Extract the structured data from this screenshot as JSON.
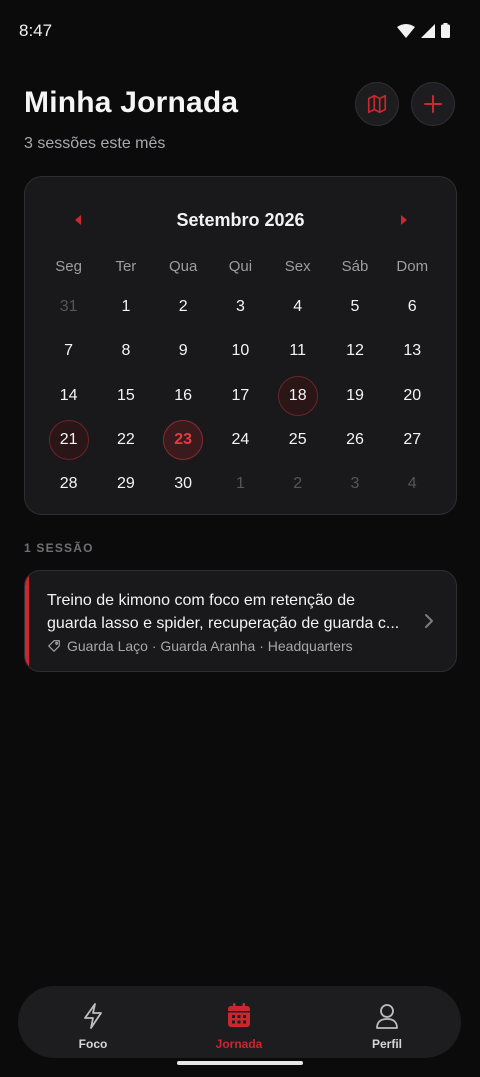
{
  "status": {
    "time": "8:47"
  },
  "header": {
    "title": "Minha Jornada",
    "subtitle": "3 sessões este mês"
  },
  "actions": {
    "map_icon": "map-icon",
    "add_icon": "plus-icon"
  },
  "calendar": {
    "month_label": "Setembro 2026",
    "weekdays": [
      "Seg",
      "Ter",
      "Qua",
      "Qui",
      "Sex",
      "Sáb",
      "Dom"
    ],
    "weeks": [
      [
        "31",
        "1",
        "2",
        "3",
        "4",
        "5",
        "6"
      ],
      [
        "7",
        "8",
        "9",
        "10",
        "11",
        "12",
        "13"
      ],
      [
        "14",
        "15",
        "16",
        "17",
        "18",
        "19",
        "20"
      ],
      [
        "21",
        "22",
        "23",
        "24",
        "25",
        "26",
        "27"
      ],
      [
        "28",
        "29",
        "30",
        "1",
        "2",
        "3",
        "4"
      ]
    ],
    "muted": [
      [
        0,
        0
      ],
      [
        4,
        3
      ],
      [
        4,
        4
      ],
      [
        4,
        5
      ],
      [
        4,
        6
      ]
    ],
    "session_days": [
      [
        2,
        4
      ],
      [
        3,
        0
      ],
      [
        3,
        2
      ]
    ],
    "today": [
      3,
      2
    ]
  },
  "sessions": {
    "count_label": "1 SESSÃO",
    "items": [
      {
        "title": "Treino de kimono com foco em retenção de guarda lasso e spider, recuperação de guarda c...",
        "tags": "Guarda Laço · Guarda Aranha · Headquarters"
      }
    ]
  },
  "nav": {
    "items": [
      {
        "label": "Foco",
        "icon": "lightning-icon"
      },
      {
        "label": "Jornada",
        "icon": "calendar-icon"
      },
      {
        "label": "Perfil",
        "icon": "person-icon"
      }
    ],
    "active_index": 1
  },
  "colors": {
    "accent": "#c8282e",
    "background": "#0b0b0c",
    "card": "#19191b"
  }
}
